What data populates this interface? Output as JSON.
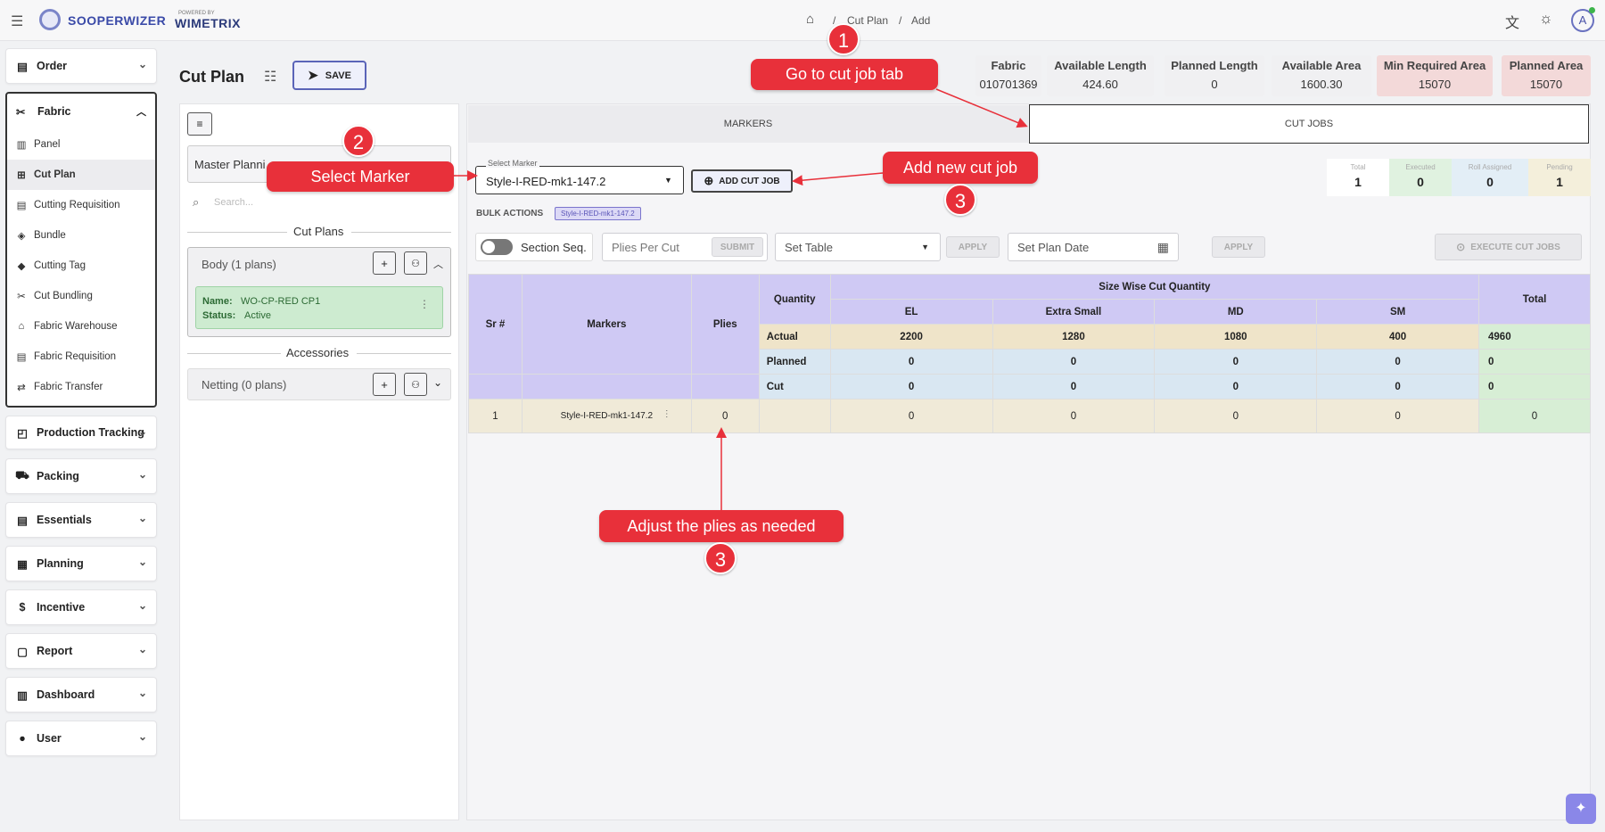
{
  "app": {
    "brand": "SOOPERWIZER",
    "powered_label": "POWERED BY",
    "powered_brand": "WIMETRIX"
  },
  "breadcrumb": {
    "home_icon": "home-icon",
    "item1": "Cut Plan",
    "sep": "/",
    "item2": "Add"
  },
  "header_icons": [
    "menu-icon",
    "translate-icon",
    "sun-icon",
    "avatar-icon"
  ],
  "avatar_letter": "A",
  "sidebar": {
    "order": "Order",
    "fabric": "Fabric",
    "fabric_items": [
      "Panel",
      "Cut Plan",
      "Cutting Requisition",
      "Bundle",
      "Cutting Tag",
      "Cut Bundling",
      "Fabric Warehouse",
      "Fabric Requisition",
      "Fabric Transfer"
    ],
    "groups": [
      "Production Tracking",
      "Packing",
      "Essentials",
      "Planning",
      "Incentive",
      "Report",
      "Dashboard",
      "User"
    ]
  },
  "page": {
    "title": "Cut Plan",
    "save_label": "SAVE"
  },
  "stats": [
    {
      "label": "Fabric",
      "value": "010701369"
    },
    {
      "label": "Available Length",
      "value": "424.60"
    },
    {
      "label": "Planned Length",
      "value": "0"
    },
    {
      "label": "Available Area",
      "value": "1600.30"
    },
    {
      "label": "Min Required Area",
      "value": "15070"
    },
    {
      "label": "Planned Area",
      "value": "15070"
    }
  ],
  "left_panel": {
    "master_label": "Master Planni",
    "search_placeholder": "Search...",
    "cut_plans_label": "Cut Plans",
    "body_group": "Body (1 plans)",
    "plan_name_label": "Name:",
    "plan_name": "WO-CP-RED CP1",
    "plan_status_label": "Status:",
    "plan_status": "Active",
    "accessories_label": "Accessories",
    "netting_group": "Netting (0 plans)"
  },
  "tabs": {
    "markers": "MARKERS",
    "cut_jobs": "CUT JOBS"
  },
  "marker_select": {
    "label": "Select Marker",
    "value": "Style-I-RED-mk1-147.2"
  },
  "add_cut_job": "ADD CUT JOB",
  "summary": [
    {
      "label": "Total",
      "value": "1"
    },
    {
      "label": "Executed",
      "value": "0"
    },
    {
      "label": "Roll Assigned",
      "value": "0"
    },
    {
      "label": "Pending",
      "value": "1"
    }
  ],
  "bulk": {
    "label": "BULK ACTIONS",
    "chip": "Style-I-RED-mk1-147.2"
  },
  "controls": {
    "section_seq": "Section Seq.",
    "plies_per_cut": "Plies Per Cut",
    "submit": "SUBMIT",
    "set_table": "Set Table",
    "apply1": "APPLY",
    "set_plan_date": "Set Plan Date",
    "apply2": "APPLY",
    "execute": "EXECUTE CUT JOBS"
  },
  "table": {
    "col_sr": "Sr #",
    "col_markers": "Markers",
    "col_plies": "Plies",
    "col_quantity": "Quantity",
    "size_header": "Size Wise Cut Quantity",
    "sizes": [
      "EL",
      "Extra Small",
      "MD",
      "SM"
    ],
    "col_total": "Total",
    "qty_rows": [
      {
        "label": "Actual",
        "values": [
          "2200",
          "1280",
          "1080",
          "400"
        ],
        "total": "4960"
      },
      {
        "label": "Planned",
        "values": [
          "0",
          "0",
          "0",
          "0"
        ],
        "total": "0"
      },
      {
        "label": "Cut",
        "values": [
          "0",
          "0",
          "0",
          "0"
        ],
        "total": "0"
      }
    ],
    "rows": [
      {
        "sr": "1",
        "marker": "Style-I-RED-mk1-147.2",
        "plies": "0",
        "values": [
          "0",
          "0",
          "0",
          "0"
        ],
        "total": "0"
      }
    ]
  },
  "callouts": {
    "c1": "Go to cut job tab",
    "n1": "1",
    "c2": "Select Marker",
    "n2": "2",
    "c3": "Add new cut job",
    "n3": "3",
    "c4": "Adjust the plies as needed",
    "n4": "3"
  }
}
